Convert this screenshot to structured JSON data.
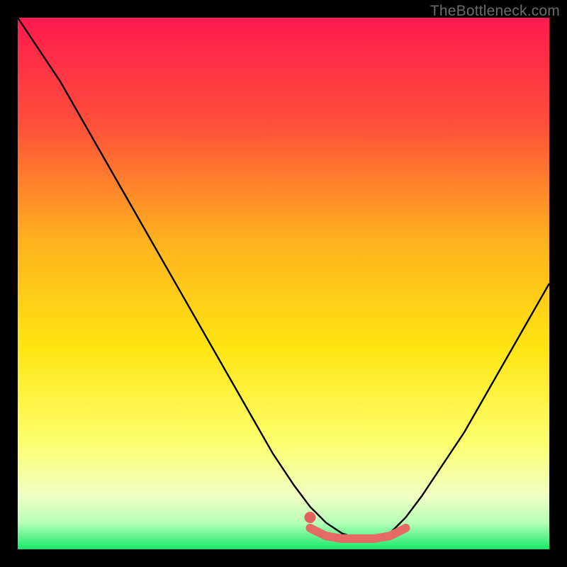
{
  "watermark": "TheBottleneck.com",
  "colors": {
    "frame": "#000000",
    "gradient_top": "#ff1a4f",
    "gradient_mid1": "#ff8b1f",
    "gradient_mid2": "#ffe512",
    "gradient_low": "#faffb0",
    "gradient_bottom": "#17e86a",
    "curve": "#000000",
    "highlight": "#e46a63",
    "dot": "#e0625f"
  },
  "chart_data": {
    "type": "line",
    "title": "",
    "xlabel": "",
    "ylabel": "",
    "xlim": [
      0,
      100
    ],
    "ylim": [
      0,
      100
    ],
    "x": [
      0,
      4,
      8,
      12,
      16,
      20,
      24,
      28,
      32,
      36,
      40,
      44,
      48,
      52,
      55,
      58,
      61,
      64,
      67,
      70,
      73,
      76,
      80,
      84,
      88,
      92,
      96,
      100
    ],
    "values": [
      100,
      94,
      88,
      81,
      74,
      67,
      60,
      53,
      46,
      39,
      32,
      25,
      18,
      12,
      8,
      5,
      3,
      2,
      2,
      3,
      6,
      10,
      16,
      22,
      29,
      36,
      43,
      50
    ],
    "highlight_segment": {
      "x": [
        55,
        58,
        61,
        64,
        67,
        70,
        73
      ],
      "values": [
        4,
        2.5,
        2,
        2,
        2,
        2.5,
        4
      ]
    },
    "marker": {
      "x": 55,
      "y": 6
    }
  }
}
